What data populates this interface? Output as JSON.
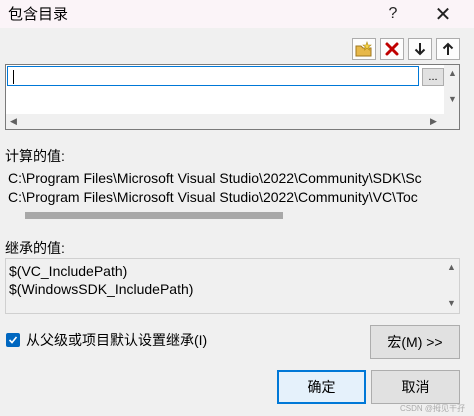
{
  "window": {
    "title": "包含目录",
    "help_glyph": "?",
    "close_glyph": "✕"
  },
  "toolbar": {
    "new_line_icon": "folder-new-icon",
    "delete_icon": "delete-x-icon",
    "move_down_icon": "arrow-down-icon",
    "move_up_icon": "arrow-up-icon",
    "colors": {
      "delete": "#c00000",
      "folder": "#d9a72c"
    }
  },
  "directory_list": {
    "value": "",
    "browse_label": "..."
  },
  "evaluated": {
    "label": "计算的值:",
    "lines": [
      "C:\\Program Files\\Microsoft Visual Studio\\2022\\Community\\SDK\\Sc",
      "C:\\Program Files\\Microsoft Visual Studio\\2022\\Community\\VC\\Toc"
    ]
  },
  "inherited": {
    "label": "继承的值:",
    "lines": [
      "$(VC_IncludePath)",
      "$(WindowsSDK_IncludePath)"
    ]
  },
  "inherit_checkbox": {
    "checked": true,
    "label": "从父级或项目默认设置继承(I)"
  },
  "buttons": {
    "macros": "宏(M) >>",
    "ok": "确定",
    "cancel": "取消"
  },
  "watermark": "CSDN @拇见干孖"
}
